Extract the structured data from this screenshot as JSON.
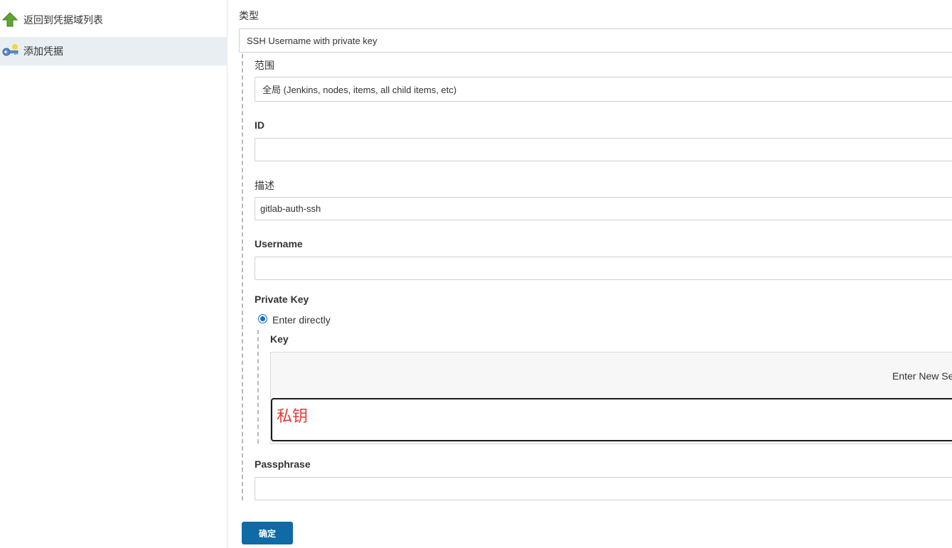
{
  "sidebar": {
    "back_label": "返回到凭据域列表",
    "add_label": "添加凭据"
  },
  "form": {
    "kind": {
      "label": "类型",
      "value": "SSH Username with private key"
    },
    "scope": {
      "label": "范围",
      "value": "全局 (Jenkins, nodes, items, all child items, etc)"
    },
    "id": {
      "label": "ID",
      "value": ""
    },
    "description": {
      "label": "描述",
      "value": "gitlab-auth-ssh"
    },
    "username": {
      "label": "Username",
      "value": ""
    },
    "private_key": {
      "label": "Private Key",
      "option_label": "Enter directly",
      "key_label": "Key",
      "secret_hint": "Enter New Sec",
      "key_value": "私钥"
    },
    "passphrase": {
      "label": "Passphrase",
      "value": ""
    },
    "submit_label": "确定"
  },
  "colors": {
    "primary_button": "#0f6aa6",
    "active_sidebar": "#e8eef1",
    "annotation_text": "#e23a3a",
    "radio": "#0f6ec9"
  },
  "icons": {
    "back": "up-arrow-icon",
    "add": "key-icon"
  }
}
